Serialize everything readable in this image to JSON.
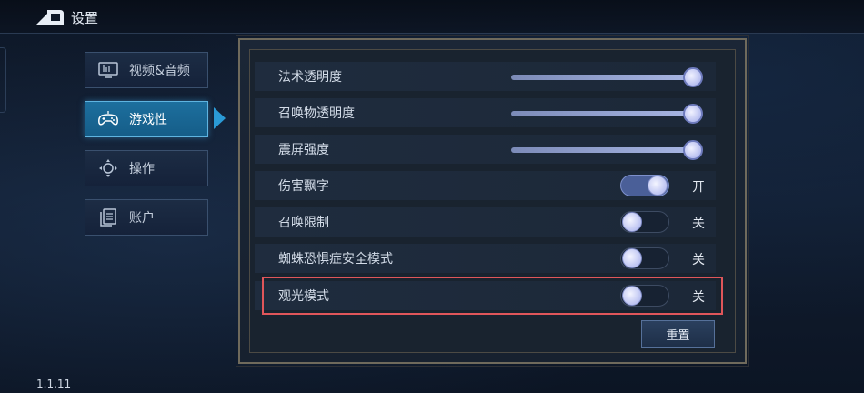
{
  "header": {
    "title": "设置"
  },
  "sidebar": {
    "items": [
      {
        "label": "视频&音频",
        "icon": "monitor-icon",
        "active": false
      },
      {
        "label": "游戏性",
        "icon": "gamepad-icon",
        "active": true
      },
      {
        "label": "操作",
        "icon": "dpad-icon",
        "active": false
      },
      {
        "label": "账户",
        "icon": "document-icon",
        "active": false
      }
    ]
  },
  "settings": {
    "rows": [
      {
        "label": "法术透明度",
        "type": "slider",
        "value": 1.0
      },
      {
        "label": "召唤物透明度",
        "type": "slider",
        "value": 1.0
      },
      {
        "label": "震屏强度",
        "type": "slider",
        "value": 1.0
      },
      {
        "label": "伤害飘字",
        "type": "toggle",
        "on": true,
        "state_text": "开"
      },
      {
        "label": "召唤限制",
        "type": "toggle",
        "on": false,
        "state_text": "关"
      },
      {
        "label": "蜘蛛恐惧症安全模式",
        "type": "toggle",
        "on": false,
        "state_text": "关"
      },
      {
        "label": "观光模式",
        "type": "toggle",
        "on": false,
        "state_text": "关"
      }
    ],
    "reset_label": "重置"
  },
  "footer": {
    "version": "1.1.11"
  },
  "colors": {
    "accent": "#2a9ad6",
    "highlight_border": "#e0565a",
    "toggle_on": "#4a5f98"
  }
}
